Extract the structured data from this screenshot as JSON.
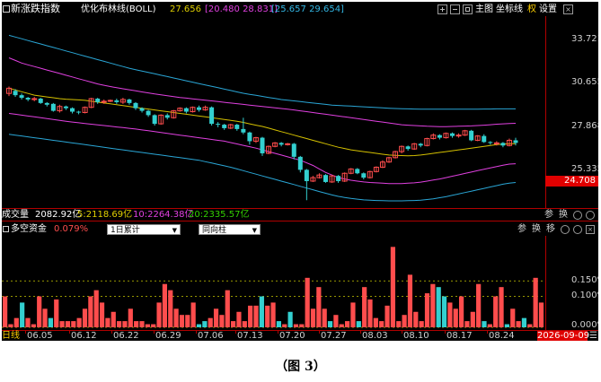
{
  "window": {
    "title": "新涨跌指数",
    "indicator": "优化布林线(BOLL)",
    "boll_values": [
      "27.656",
      "[20.480 28.831]",
      "[25.657 29.654]"
    ],
    "toolbar": {
      "main_chart": "主图",
      "axis": "坐标线",
      "weight": "权",
      "settings": "设置"
    }
  },
  "colors": {
    "up": "#ff4d4d",
    "down": "#33d0d0",
    "mid": "#d4c000",
    "upper_band": "#e040e0",
    "outer_band": "#2aa6d6",
    "accent_red": "#ff0000"
  },
  "price_axis": {
    "labels": [
      "33.721",
      "30.655",
      "27.868",
      "25.335",
      "24.708"
    ],
    "current": "24.708"
  },
  "volume_bar": {
    "label": "成交量",
    "value": "2082.92亿",
    "ma5": "5:2118.69亿",
    "ma10": "10:2264.38亿",
    "ma20": "20:2335.57亿",
    "icons": [
      "参",
      "换"
    ]
  },
  "fund_panel": {
    "title": "多空资金",
    "pct": "0.079%",
    "select_period": "1日累计",
    "select_type": "同向柱",
    "icons": [
      "参",
      "换",
      "移"
    ],
    "axis_labels": [
      "0.150%",
      "0.100%",
      "0.000%"
    ]
  },
  "x_axis": {
    "prefix": "日线",
    "dates": [
      "06.05",
      "06.12",
      "06.22",
      "06.29",
      "07.06",
      "07.13",
      "07.20",
      "07.27",
      "08.03",
      "08.10",
      "08.17",
      "08.24"
    ],
    "current_date": "2026-09-09"
  },
  "caption": "（图 3）",
  "chart_data": [
    {
      "type": "candlestick",
      "title": "新涨跌指数",
      "y_axis_labels": [
        33.721,
        30.655,
        27.868,
        25.335
      ],
      "ylim": [
        24.0,
        34.9
      ],
      "x_tick_labels": [
        "06.05",
        "06.12",
        "06.22",
        "06.29",
        "07.06",
        "07.13",
        "07.20",
        "07.27",
        "08.03",
        "08.10",
        "08.17",
        "08.24"
      ],
      "candles": [
        [
          30.55,
          30.85,
          30.4,
          30.95
        ],
        [
          30.7,
          30.45,
          30.35,
          30.8
        ],
        [
          30.45,
          30.3,
          30.2,
          30.55
        ],
        [
          30.3,
          30.2,
          30.1,
          30.35
        ],
        [
          30.2,
          30.25,
          30.1,
          30.35
        ],
        [
          30.25,
          30.0,
          29.95,
          30.3
        ],
        [
          30.0,
          29.9,
          29.8,
          30.05
        ],
        [
          29.95,
          29.55,
          29.5,
          30.0
        ],
        [
          29.55,
          29.8,
          29.45,
          29.9
        ],
        [
          29.8,
          29.7,
          29.6,
          29.85
        ],
        [
          29.7,
          29.5,
          29.4,
          29.75
        ],
        [
          29.5,
          29.45,
          29.35,
          29.55
        ],
        [
          29.45,
          29.75,
          29.4,
          29.8
        ],
        [
          29.75,
          30.25,
          29.7,
          30.3
        ],
        [
          30.25,
          30.05,
          29.95,
          30.3
        ],
        [
          30.05,
          30.1,
          29.95,
          30.2
        ],
        [
          30.1,
          30.15,
          30.05,
          30.2
        ],
        [
          30.15,
          30.05,
          29.95,
          30.25
        ],
        [
          30.05,
          30.2,
          29.95,
          30.3
        ],
        [
          30.2,
          30.0,
          29.9,
          30.25
        ],
        [
          30.0,
          29.7,
          29.6,
          30.05
        ],
        [
          29.7,
          29.55,
          29.45,
          29.75
        ],
        [
          29.55,
          29.3,
          29.2,
          29.6
        ],
        [
          29.3,
          28.8,
          28.7,
          29.35
        ],
        [
          28.8,
          29.3,
          28.75,
          29.35
        ],
        [
          29.3,
          29.15,
          29.05,
          29.4
        ],
        [
          29.15,
          29.55,
          29.1,
          29.6
        ],
        [
          29.55,
          29.7,
          29.5,
          29.75
        ],
        [
          29.7,
          29.5,
          29.4,
          29.75
        ],
        [
          29.5,
          29.75,
          29.45,
          29.8
        ],
        [
          29.75,
          29.6,
          29.5,
          29.85
        ],
        [
          29.6,
          29.75,
          29.55,
          29.85
        ],
        [
          29.75,
          28.8,
          28.7,
          29.8
        ],
        [
          28.8,
          28.75,
          28.6,
          28.9
        ],
        [
          28.75,
          28.55,
          28.45,
          28.8
        ],
        [
          28.55,
          28.75,
          28.5,
          28.8
        ],
        [
          28.75,
          28.5,
          28.4,
          28.8
        ],
        [
          28.5,
          28.3,
          28.2,
          29.15
        ],
        [
          28.3,
          27.8,
          27.6,
          28.35
        ],
        [
          27.8,
          28.0,
          27.7,
          28.05
        ],
        [
          28.0,
          27.1,
          26.95,
          28.05
        ],
        [
          27.1,
          27.5,
          27.05,
          27.55
        ],
        [
          27.5,
          27.7,
          27.45,
          27.75
        ],
        [
          27.7,
          27.6,
          27.5,
          27.75
        ],
        [
          27.6,
          27.65,
          27.55,
          27.7
        ],
        [
          27.65,
          26.9,
          26.75,
          27.7
        ],
        [
          26.9,
          26.15,
          26.0,
          26.95
        ],
        [
          26.15,
          25.5,
          24.4,
          26.2
        ],
        [
          25.5,
          25.7,
          25.45,
          25.8
        ],
        [
          25.7,
          25.85,
          25.65,
          25.95
        ],
        [
          25.85,
          25.45,
          25.4,
          25.9
        ],
        [
          25.45,
          25.8,
          25.4,
          25.85
        ],
        [
          25.8,
          25.5,
          25.4,
          25.85
        ],
        [
          25.5,
          25.95,
          25.45,
          26.0
        ],
        [
          25.95,
          26.2,
          25.9,
          26.25
        ],
        [
          26.2,
          25.95,
          25.9,
          26.25
        ],
        [
          25.95,
          25.7,
          25.6,
          26.0
        ],
        [
          25.7,
          26.05,
          25.65,
          26.1
        ],
        [
          26.05,
          26.3,
          26.0,
          26.35
        ],
        [
          26.3,
          26.6,
          26.25,
          26.7
        ],
        [
          26.6,
          26.85,
          26.55,
          26.9
        ],
        [
          26.85,
          27.2,
          26.8,
          27.25
        ],
        [
          27.2,
          27.5,
          27.1,
          27.55
        ],
        [
          27.5,
          27.35,
          27.25,
          27.55
        ],
        [
          27.35,
          27.65,
          27.3,
          27.7
        ],
        [
          27.65,
          27.55,
          27.45,
          27.7
        ],
        [
          27.55,
          27.95,
          27.5,
          28.0
        ],
        [
          27.95,
          28.15,
          27.9,
          28.25
        ],
        [
          28.15,
          28.0,
          27.9,
          28.2
        ],
        [
          28.0,
          28.25,
          27.95,
          28.3
        ],
        [
          28.25,
          28.1,
          28.0,
          28.3
        ],
        [
          28.1,
          28.15,
          28.0,
          28.25
        ],
        [
          28.15,
          28.4,
          28.1,
          28.45
        ],
        [
          28.4,
          27.85,
          27.8,
          28.45
        ],
        [
          27.85,
          28.1,
          27.8,
          28.15
        ],
        [
          28.1,
          27.75,
          27.7,
          28.2
        ],
        [
          27.75,
          27.7,
          27.6,
          27.8
        ],
        [
          27.7,
          27.7,
          27.55,
          27.8
        ],
        [
          27.7,
          27.55,
          27.45,
          27.75
        ],
        [
          27.55,
          27.85,
          27.5,
          27.95
        ],
        [
          27.85,
          27.7,
          27.55,
          28.0
        ]
      ],
      "series": [
        {
          "name": "MID",
          "values": [
            30.85,
            30.75,
            30.65,
            30.55,
            30.45,
            30.4,
            30.35,
            30.3,
            30.25,
            30.22,
            30.2,
            30.18,
            30.15,
            30.1,
            30.05,
            30.0,
            29.95,
            29.9,
            29.85,
            29.8,
            29.75,
            29.7,
            29.65,
            29.6,
            29.55,
            29.5,
            29.45,
            29.4,
            29.35,
            29.3,
            29.25,
            29.2,
            29.15,
            29.1,
            29.05,
            29.0,
            28.95,
            28.88,
            28.8,
            28.72,
            28.65,
            28.55,
            28.45,
            28.35,
            28.25,
            28.15,
            28.05,
            27.95,
            27.85,
            27.75,
            27.65,
            27.55,
            27.45,
            27.38,
            27.3,
            27.25,
            27.2,
            27.15,
            27.1,
            27.05,
            27.0,
            26.98,
            26.97,
            26.96,
            26.97,
            27.0,
            27.05,
            27.1,
            27.15,
            27.2,
            27.25,
            27.3,
            27.35,
            27.4,
            27.45,
            27.5,
            27.55,
            27.6,
            27.63,
            27.65,
            27.66
          ]
        },
        {
          "name": "UPPER",
          "values": [
            32.6,
            32.45,
            32.3,
            32.2,
            32.1,
            32.0,
            31.9,
            31.8,
            31.7,
            31.6,
            31.5,
            31.4,
            31.3,
            31.2,
            31.1,
            31.02,
            30.95,
            30.88,
            30.82,
            30.76,
            30.7,
            30.64,
            30.58,
            30.52,
            30.47,
            30.42,
            30.37,
            30.32,
            30.28,
            30.24,
            30.2,
            30.16,
            30.12,
            30.08,
            30.04,
            30.0,
            29.96,
            29.92,
            29.88,
            29.84,
            29.8,
            29.76,
            29.72,
            29.68,
            29.64,
            29.6,
            29.55,
            29.5,
            29.45,
            29.4,
            29.35,
            29.3,
            29.25,
            29.2,
            29.15,
            29.1,
            29.05,
            29.0,
            28.95,
            28.9,
            28.85,
            28.8,
            28.75,
            28.72,
            28.7,
            28.68,
            28.66,
            28.65,
            28.64,
            28.64,
            28.65,
            28.66,
            28.67,
            28.68,
            28.7,
            28.72,
            28.75,
            28.78,
            28.8,
            28.82,
            28.83
          ]
        },
        {
          "name": "LOWER",
          "values": [
            29.4,
            29.35,
            29.3,
            29.25,
            29.2,
            29.15,
            29.1,
            29.05,
            29.0,
            28.95,
            28.9,
            28.86,
            28.82,
            28.78,
            28.74,
            28.7,
            28.66,
            28.62,
            28.58,
            28.54,
            28.5,
            28.45,
            28.4,
            28.35,
            28.3,
            28.25,
            28.2,
            28.15,
            28.1,
            28.05,
            28.0,
            27.95,
            27.9,
            27.85,
            27.8,
            27.72,
            27.64,
            27.56,
            27.48,
            27.4,
            27.3,
            27.2,
            27.1,
            27.0,
            26.9,
            26.8,
            26.7,
            26.55,
            26.4,
            26.2,
            26.0,
            25.85,
            25.7,
            25.62,
            25.55,
            25.5,
            25.45,
            25.42,
            25.4,
            25.38,
            25.36,
            25.36,
            25.36,
            25.38,
            25.4,
            25.44,
            25.5,
            25.56,
            25.62,
            25.7,
            25.78,
            25.86,
            25.94,
            26.02,
            26.1,
            26.18,
            26.26,
            26.34,
            26.42,
            26.48,
            26.5
          ]
        },
        {
          "name": "OUTER_UPPER",
          "values": [
            33.9,
            33.8,
            33.7,
            33.6,
            33.5,
            33.4,
            33.3,
            33.2,
            33.1,
            33.0,
            32.9,
            32.8,
            32.7,
            32.6,
            32.5,
            32.4,
            32.3,
            32.2,
            32.1,
            32.0,
            31.92,
            31.84,
            31.76,
            31.68,
            31.6,
            31.52,
            31.44,
            31.36,
            31.28,
            31.2,
            31.12,
            31.04,
            30.96,
            30.88,
            30.8,
            30.72,
            30.64,
            30.56,
            30.5,
            30.44,
            30.38,
            30.32,
            30.26,
            30.2,
            30.16,
            30.12,
            30.08,
            30.04,
            30.0,
            29.96,
            29.92,
            29.88,
            29.86,
            29.84,
            29.82,
            29.8,
            29.78,
            29.76,
            29.74,
            29.72,
            29.7,
            29.68,
            29.67,
            29.66,
            29.65,
            29.64,
            29.64,
            29.64,
            29.64,
            29.64,
            29.64,
            29.64,
            29.64,
            29.64,
            29.64,
            29.65,
            29.65,
            29.66,
            29.66,
            29.66,
            29.66
          ]
        },
        {
          "name": "OUTER_LOWER",
          "values": [
            28.2,
            28.15,
            28.1,
            28.05,
            28.0,
            27.95,
            27.9,
            27.85,
            27.8,
            27.75,
            27.7,
            27.65,
            27.6,
            27.55,
            27.5,
            27.45,
            27.4,
            27.35,
            27.3,
            27.25,
            27.2,
            27.15,
            27.1,
            27.05,
            27.0,
            26.95,
            26.9,
            26.85,
            26.8,
            26.75,
            26.7,
            26.62,
            26.54,
            26.46,
            26.38,
            26.3,
            26.2,
            26.1,
            26.0,
            25.9,
            25.8,
            25.7,
            25.6,
            25.5,
            25.4,
            25.3,
            25.2,
            25.1,
            25.0,
            24.9,
            24.8,
            24.7,
            24.62,
            24.56,
            24.5,
            24.46,
            24.42,
            24.4,
            24.38,
            24.37,
            24.36,
            24.36,
            24.36,
            24.37,
            24.38,
            24.4,
            24.44,
            24.48,
            24.54,
            24.6,
            24.68,
            24.76,
            24.84,
            24.92,
            25.0,
            25.08,
            25.16,
            25.24,
            25.32,
            25.38,
            25.42
          ]
        }
      ]
    },
    {
      "type": "bar",
      "title": "多空资金",
      "y_axis_labels": [
        0.15,
        0.1,
        0.0
      ],
      "ylim": [
        0,
        0.29
      ],
      "values": [
        0.1,
        0.01,
        0.03,
        0.08,
        0.03,
        0.01,
        0.1,
        0.06,
        0.03,
        0.09,
        0.02,
        0.02,
        0.02,
        0.03,
        0.06,
        0.1,
        0.12,
        0.08,
        0.03,
        0.05,
        0.02,
        0.02,
        0.06,
        0.02,
        0.02,
        0.01,
        0.01,
        0.08,
        0.14,
        0.12,
        0.06,
        0.04,
        0.04,
        0.08,
        0.01,
        0.02,
        0.03,
        0.06,
        0.04,
        0.12,
        0.02,
        0.05,
        0.02,
        0.07,
        0.07,
        0.1,
        0.07,
        0.08,
        0.02,
        0.01,
        0.05,
        0.01,
        0.01,
        0.16,
        0.06,
        0.13,
        0.06,
        0.02,
        0.04,
        0.01,
        0.02,
        0.08,
        0.02,
        0.13,
        0.09,
        0.03,
        0.02,
        0.07,
        0.26,
        0.02,
        0.04,
        0.17,
        0.05,
        0.02,
        0.11,
        0.14,
        0.13,
        0.1,
        0.08,
        0.06,
        0.1,
        0.02,
        0.05,
        0.14,
        0.02,
        0.01,
        0.1,
        0.13,
        0.01,
        0.06,
        0.02,
        0.03,
        0.01,
        0.16,
        0.08
      ],
      "down_flags": [
        0,
        0,
        0,
        1,
        0,
        0,
        0,
        0,
        1,
        0,
        0,
        0,
        0,
        0,
        0,
        0,
        0,
        0,
        0,
        0,
        0,
        0,
        0,
        0,
        0,
        0,
        0,
        0,
        0,
        0,
        0,
        0,
        0,
        0,
        1,
        1,
        0,
        0,
        0,
        0,
        0,
        0,
        0,
        0,
        0,
        1,
        0,
        0,
        1,
        0,
        1,
        0,
        0,
        0,
        0,
        0,
        0,
        1,
        0,
        0,
        0,
        0,
        1,
        0,
        0,
        0,
        0,
        0,
        0,
        0,
        0,
        0,
        0,
        0,
        0,
        0,
        1,
        1,
        0,
        0,
        0,
        0,
        0,
        0,
        1,
        0,
        0,
        0,
        1,
        0,
        0,
        1,
        0,
        0,
        0
      ]
    }
  ]
}
